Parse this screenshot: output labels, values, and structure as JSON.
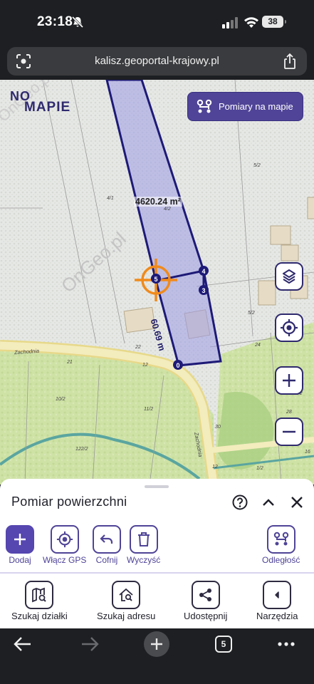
{
  "status_bar": {
    "time": "23:18",
    "battery": "38"
  },
  "browser": {
    "url": "kalisz.geoportal-krajowy.pl",
    "tab_count": "5"
  },
  "map": {
    "logo_line1": "NO",
    "logo_line2": "MAPIE",
    "measure_button_label": "Pomiary na mapie",
    "area_label": "4620.24 m²",
    "distance_label": "60.69 m",
    "vertex_labels": [
      "5",
      "4",
      "3",
      "0"
    ],
    "parcel_labels": [
      "4/1",
      "4/2",
      "5/2",
      "5/2",
      "22",
      "24",
      "21",
      "12",
      "10/2",
      "11/2",
      "12/2",
      "122/2",
      "30",
      "28",
      "14",
      "16",
      "1/2",
      "12"
    ],
    "street_labels": [
      "Zachodnia",
      "Zachodnia"
    ],
    "watermark": "OnGeo.pl"
  },
  "panel": {
    "title": "Pomiar powierzchni",
    "tools": {
      "add": "Dodaj",
      "gps": "Włącz GPS",
      "undo": "Cofnij",
      "clear": "Wyczyść",
      "distance": "Odległość"
    },
    "nav": {
      "parcel": "Szukaj działki",
      "address": "Szukaj adresu",
      "share": "Udostępnij",
      "tools": "Narzędzia"
    }
  },
  "colors": {
    "brand": "#4f4497",
    "measure_fill": "#a9a8e0",
    "measure_stroke": "#1e1a77",
    "crosshair": "#f08a1c"
  }
}
